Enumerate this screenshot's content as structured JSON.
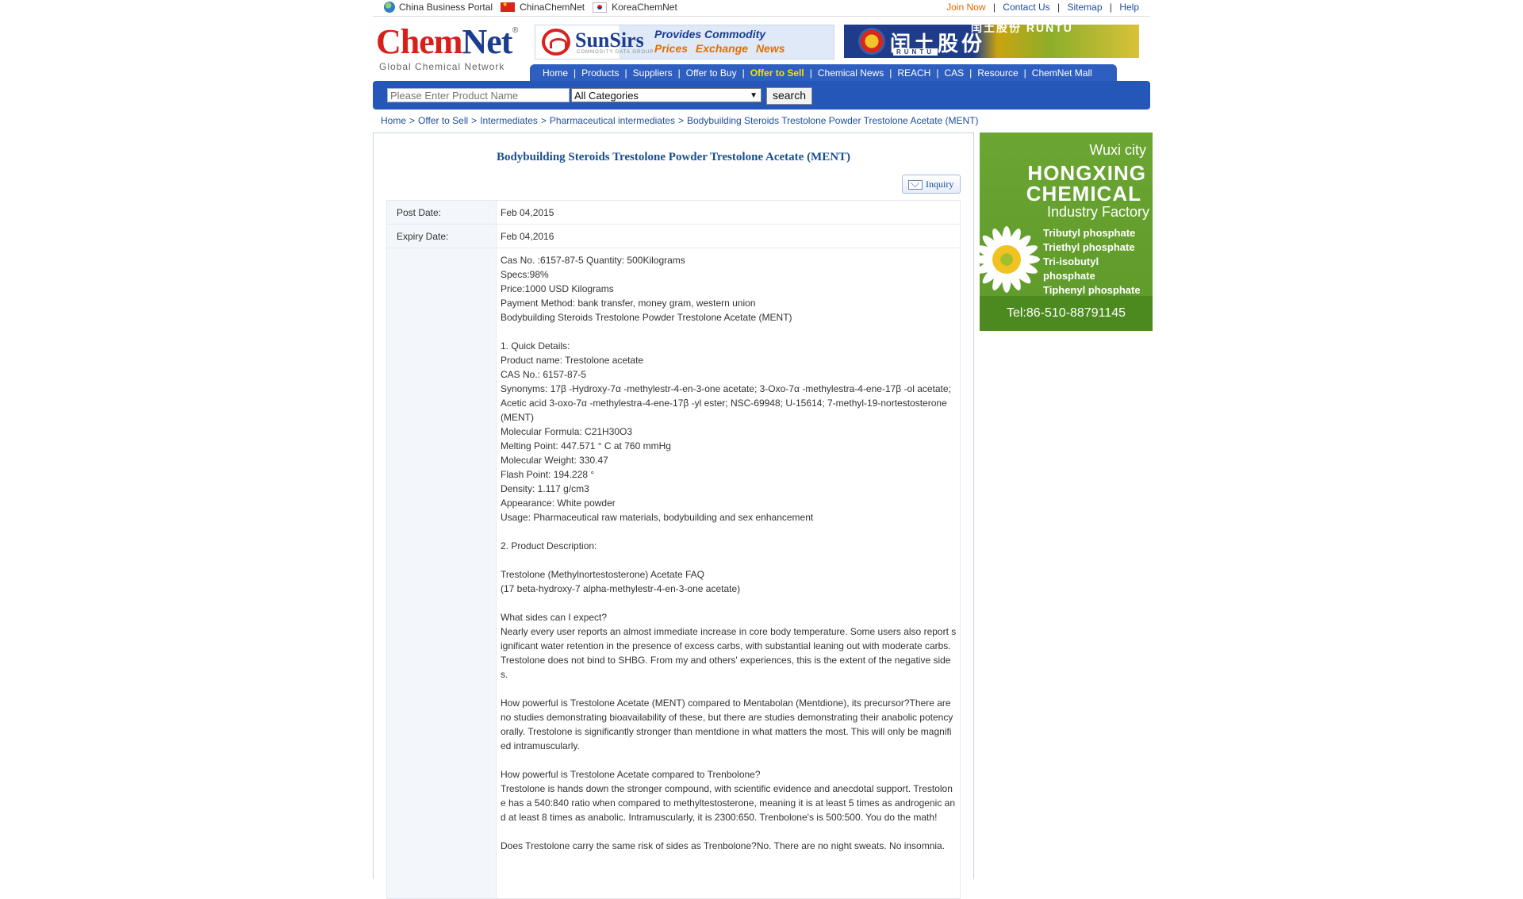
{
  "topbar": {
    "links_left": [
      "China Business Portal",
      "ChinaChemNet",
      "KoreaChemNet"
    ],
    "join": "Join Now",
    "contact": "Contact Us",
    "sitemap": "Sitemap",
    "help": "Help",
    "sep": "|"
  },
  "logo": {
    "part1": "Chem",
    "part2": "Net",
    "reg": "®",
    "sub": "Global Chemical Network"
  },
  "banner_sunsirs": {
    "name": "SunSirs",
    "sub": "COMMODITY DATA GROUP",
    "tag1": "Provides Commodity",
    "tag2": "Prices Exchange News"
  },
  "banner_runtu": {
    "name": "闰土股份",
    "en": "RUNTU",
    "top": "闰土股份 RUNTU"
  },
  "nav": {
    "items": [
      "Home",
      "Products",
      "Suppliers",
      "Offer to Buy",
      "Offer to Sell",
      "Chemical News",
      "REACH",
      "CAS",
      "Resource",
      "ChemNet Mall"
    ],
    "active": "Offer to Sell"
  },
  "search": {
    "placeholder": "Please Enter Product Name",
    "category": "All Categories",
    "button": "search"
  },
  "breadcrumb": [
    "Home",
    "Offer to Sell",
    "Intermediates",
    "Pharmaceutical intermediates",
    "Bodybuilding Steroids Trestolone Powder Trestolone Acetate (MENT)"
  ],
  "product": {
    "title": "Bodybuilding Steroids Trestolone Powder Trestolone Acetate (MENT)",
    "inquiry": "Inquiry",
    "post_date_label": "Post Date:",
    "post_date": "Feb 04,2015",
    "expiry_date_label": "Expiry Date:",
    "expiry_date": "Feb 04,2016",
    "description": [
      "Cas No. :6157-87-5 Quantity: 500Kilograms",
      "Specs:98%",
      "Price:1000 USD Kilograms",
      "Payment Method: bank transfer, money gram, western union",
      "Bodybuilding Steroids Trestolone Powder Trestolone Acetate (MENT)",
      "",
      "1. Quick Details:",
      "Product name: Trestolone acetate",
      "CAS No.: 6157-87-5",
      "Synonyms: 17β -Hydroxy-7α -methylestr-4-en-3-one acetate; 3-Oxo-7α -methylestra-4-ene-17β -ol acetate; Acetic acid 3-oxo-7α -methylestra-4-ene-17β -yl ester; NSC-69948; U-15614; 7-methyl-19-nortestosterone (MENT)",
      "Molecular Formula: C21H30O3",
      "Melting Point: 447.571 ° C at 760 mmHg",
      "Molecular Weight: 330.47",
      "Flash Point: 194.228 °",
      "Density: 1.117 g/cm3",
      "Appearance: White powder",
      "Usage: Pharmaceutical raw materials, bodybuilding and sex enhancement",
      "",
      "2. Product Description:",
      "",
      "Trestolone (Methylnortestosterone) Acetate FAQ",
      "(17 beta-hydroxy-7 alpha-methylestr-4-en-3-one acetate)",
      "",
      "What sides can I expect?",
      "Nearly every user reports an almost immediate increase in core body temperature. Some users also report significant water retention in the presence of excess carbs, with substantial leaning out with moderate carbs. Trestolone does not bind to SHBG. From my and others' experiences, this is the extent of the negative sides.",
      "",
      "How powerful is Trestolone Acetate (MENT) compared to Mentabolan (Mentdione), its precursor?There are no studies demonstrating bioavailability of these, but there are studies demonstrating their anabolic potency orally. Trestolone is significantly stronger than mentdione in what matters the most. This will only be magnified intramuscularly.",
      "",
      "How powerful is Trestolone Acetate compared to Trenbolone?",
      "Trestolone is hands down the stronger compound, with scientific evidence and anecdotal support. Trestolone has a 540:840 ratio when compared to methyltestosterone, meaning it is at least 5 times as androgenic and at least 8 times as anabolic. Intramuscularly, it is 2300:650. Trenbolone's is 500:500. You do the math!",
      "",
      "Does Trestolone carry the same risk of sides as Trenbolone?No. There are no night sweats. No insomnia."
    ]
  },
  "ad": {
    "city": "Wuxi city",
    "line1": "HONGXING",
    "line2": "CHEMICAL",
    "line3": "Industry Factory",
    "products": [
      "Tributyl phosphate",
      "Triethyl phosphate",
      "Tri-isobutyl phosphate",
      "Tiphenyl phosphate"
    ],
    "tel": "Tel:86-510-88791145"
  },
  "colors": {
    "nav_blue": "#2e5fc0",
    "search_blue": "#2457b8",
    "link_blue": "#1c4d9c",
    "active_yellow": "#ffde00",
    "join_orange": "#e06a00"
  }
}
